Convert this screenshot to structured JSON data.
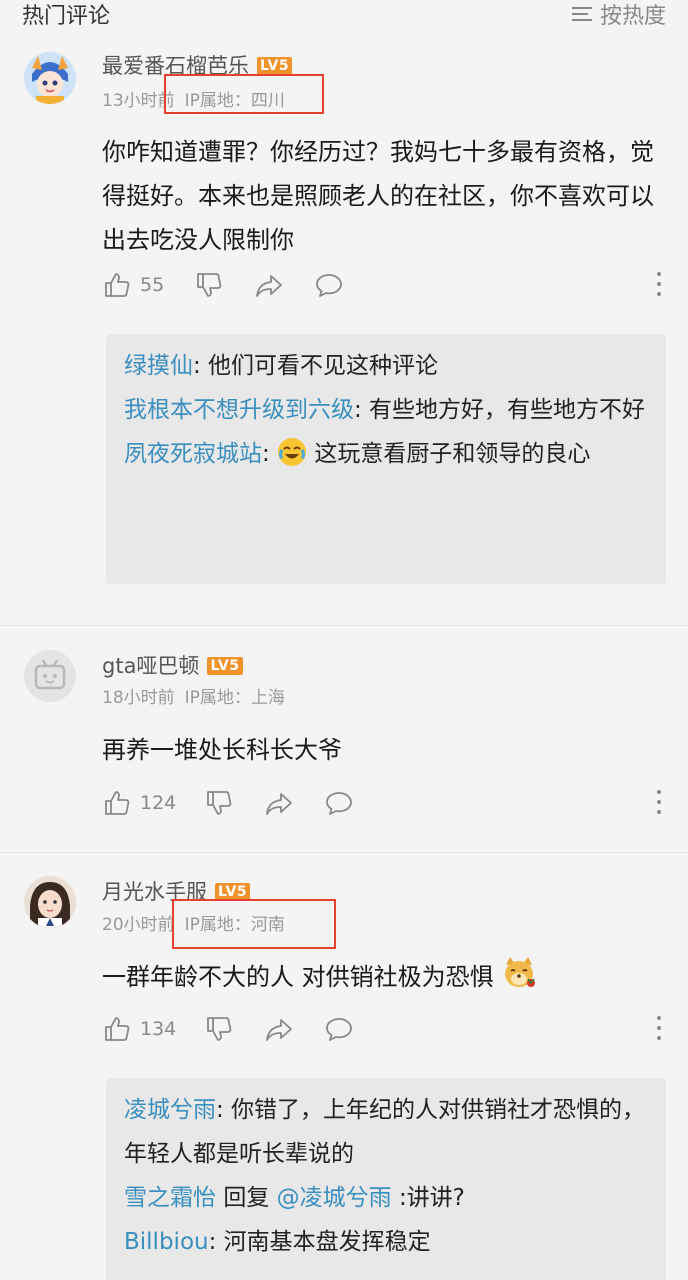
{
  "header": {
    "title": "热门评论",
    "sort_label": "按热度"
  },
  "comments": [
    {
      "username": "最爱番石榴芭乐",
      "level": "LV5",
      "time": "13小时前",
      "ip": "IP属地：四川",
      "text": "你咋知道遭罪？你经历过？我妈七十多最有资格，觉得挺好。本来也是照顾老人的在社区，你不喜欢可以出去吃没人限制你",
      "likes": "55",
      "replies": [
        {
          "user": "绿摸仙",
          "text": ": 他们可看不见这种评论"
        },
        {
          "user": "我根本不想升级到六级",
          "text": ": 有些地方好，有些地方不好"
        },
        {
          "user": "夙夜死寂城站",
          "text": "这玩意看厨子和领导的良心",
          "emoji": "laughing-crying-emoji"
        }
      ]
    },
    {
      "username": "gta哑巴顿",
      "level": "LV5",
      "time": "18小时前",
      "ip": "IP属地：上海",
      "text": "再养一堆处长科长大爷",
      "likes": "124"
    },
    {
      "username": "月光水手服",
      "level": "LV5",
      "time": "20小时前",
      "ip": "IP属地：河南",
      "text": "一群年龄不大的人 对供销社极为恐惧",
      "likes": "134",
      "replies": [
        {
          "user": "凌城兮雨",
          "text": ": 你错了，上年纪的人对供销社才恐惧的，年轻人都是听长辈说的"
        },
        {
          "user": "雪之霜怡",
          "reply_word": "回复",
          "mention": "@凌城兮雨",
          "text": ":讲讲?"
        },
        {
          "user": "Billbiou",
          "text": ": 河南基本盘发挥稳定"
        }
      ]
    }
  ],
  "colors": {
    "link_blue": "#3a8fc0",
    "level_orange": "#f0932b",
    "highlight_red": "#e8412b"
  }
}
